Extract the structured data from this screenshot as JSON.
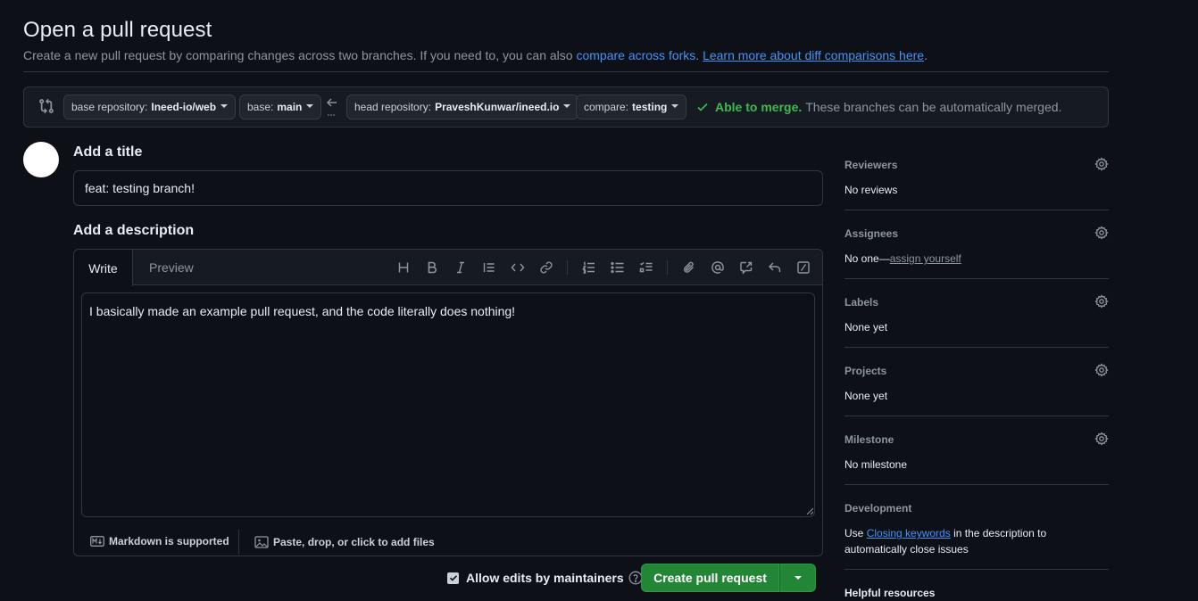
{
  "page": {
    "title": "Open a pull request",
    "subtitle_text": "Create a new pull request by comparing changes across two branches. If you need to, you can also ",
    "compare_forks_link": "compare across forks",
    "learn_more_link": "Learn more about diff comparisons here"
  },
  "range": {
    "base_repo_label": "base repository:",
    "base_repo_value": "Ineed-io/web",
    "base_label": "base:",
    "base_value": "main",
    "head_repo_label": "head repository:",
    "head_repo_value": "PraveshKunwar/ineed.io",
    "compare_label": "compare:",
    "compare_value": "testing",
    "merge_status": "Able to merge.",
    "merge_note": "These branches can be automatically merged."
  },
  "form": {
    "title_label": "Add a title",
    "title_value": "feat: testing branch!",
    "description_label": "Add a description",
    "tab_write": "Write",
    "tab_preview": "Preview",
    "body_value": "I basically made an example pull request, and the code literally does nothing!",
    "markdown_note": "Markdown is supported",
    "attach_note": "Paste, drop, or click to add files",
    "allow_edits_label": "Allow edits by maintainers",
    "allow_edits_checked": true,
    "create_button": "Create pull request"
  },
  "sidebar": {
    "reviewers": {
      "title": "Reviewers",
      "value": "No reviews"
    },
    "assignees": {
      "title": "Assignees",
      "value": "No one—",
      "link": "assign yourself"
    },
    "labels": {
      "title": "Labels",
      "value": "None yet"
    },
    "projects": {
      "title": "Projects",
      "value": "None yet"
    },
    "milestone": {
      "title": "Milestone",
      "value": "No milestone"
    },
    "development": {
      "title": "Development",
      "prefix": "Use ",
      "link": "Closing keywords",
      "suffix": " in the description to automatically close issues"
    },
    "helpful": {
      "title": "Helpful resources"
    }
  },
  "colors": {
    "background": "#0d1117",
    "accent_link": "#4493f8",
    "success": "#3fb950",
    "primary_button": "#238636"
  }
}
